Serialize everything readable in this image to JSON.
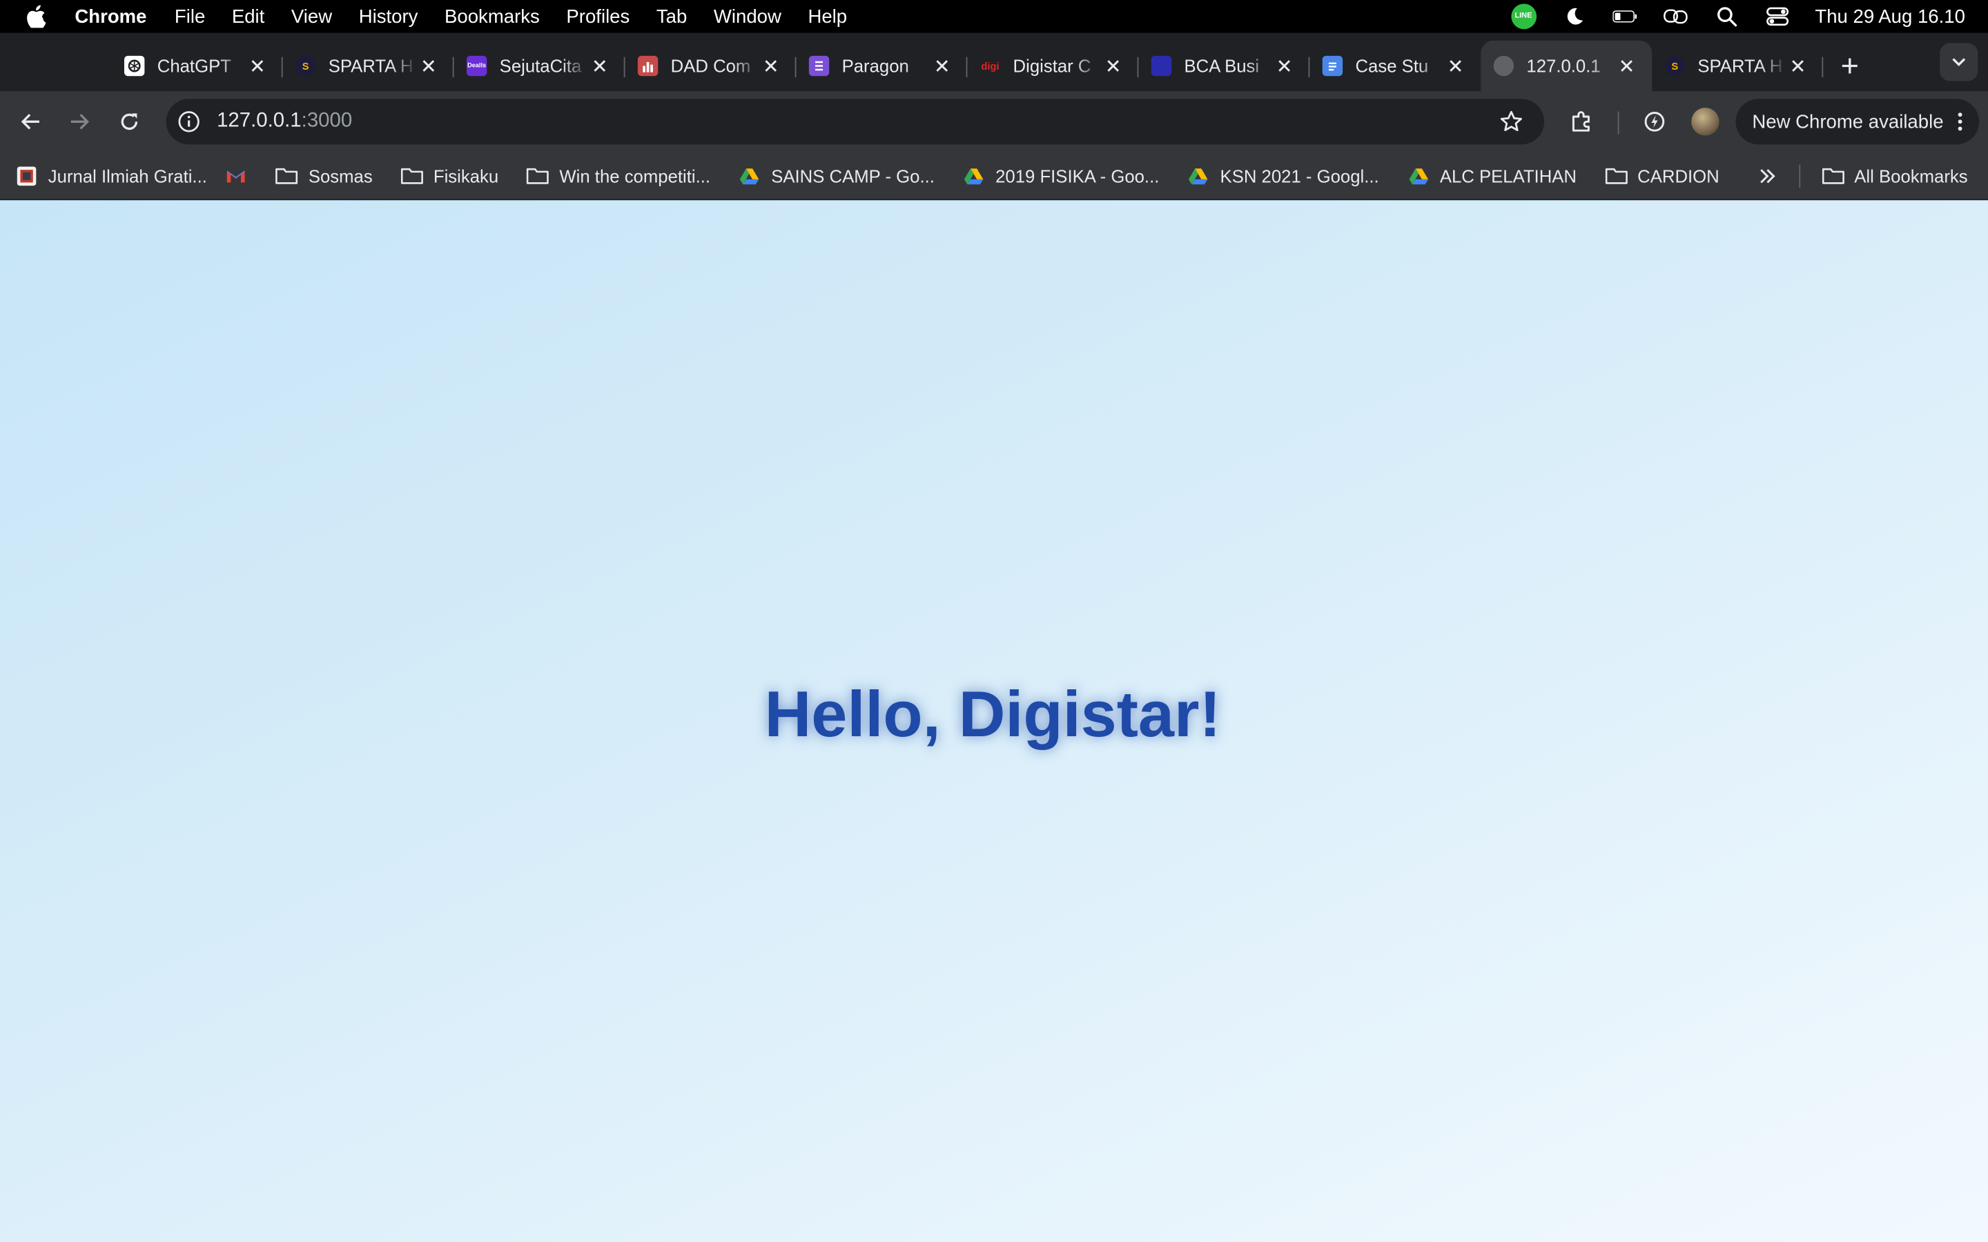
{
  "menubar": {
    "app_name": "Chrome",
    "items": [
      "File",
      "Edit",
      "View",
      "History",
      "Bookmarks",
      "Profiles",
      "Tab",
      "Window",
      "Help"
    ],
    "line_badge": "LINE",
    "clock": "Thu 29 Aug  16.10"
  },
  "tabs": [
    {
      "title": "ChatGPT",
      "icon": "chatgpt-icon",
      "color": "#ffffff"
    },
    {
      "title": "SPARTA H",
      "icon": "sparta-icon",
      "color": "#1c1c3a"
    },
    {
      "title": "SejutaCita",
      "icon": "sejutacita-icon",
      "color": "#6a2fd6"
    },
    {
      "title": "DAD Com",
      "icon": "dad-icon",
      "color": "#c84a4a"
    },
    {
      "title": "Paragon",
      "icon": "forms-icon",
      "color": "#7b4fd6"
    },
    {
      "title": "Digistar C",
      "icon": "digistar-icon",
      "color": "#e02424"
    },
    {
      "title": "BCA Busi",
      "icon": "bca-icon",
      "color": "#2b2bb0"
    },
    {
      "title": "Case Stu",
      "icon": "docs-icon",
      "color": "#4a86e8"
    },
    {
      "title": "127.0.0.1",
      "icon": "globe-icon",
      "color": "#5f6368",
      "active": true
    },
    {
      "title": "SPARTA H",
      "icon": "sparta-icon",
      "color": "#1c1c3a"
    }
  ],
  "omnibox": {
    "host": "127.0.0.1",
    "port": ":3000"
  },
  "update_pill": "New Chrome available",
  "bookmarks": [
    {
      "label": "Jurnal Ilmiah Grati...",
      "icon": "site-favicon"
    },
    {
      "label": "",
      "icon": "gmail-icon"
    },
    {
      "label": "Sosmas",
      "icon": "folder-icon"
    },
    {
      "label": "Fisikaku",
      "icon": "folder-icon"
    },
    {
      "label": "Win the competiti...",
      "icon": "folder-icon"
    },
    {
      "label": "SAINS CAMP - Go...",
      "icon": "drive-icon"
    },
    {
      "label": "2019 FISIKA - Goo...",
      "icon": "drive-icon"
    },
    {
      "label": "KSN 2021 - Googl...",
      "icon": "drive-icon"
    },
    {
      "label": "ALC PELATIHAN",
      "icon": "drive-icon"
    },
    {
      "label": "CARDION",
      "icon": "folder-icon"
    }
  ],
  "all_bookmarks": "All Bookmarks",
  "page": {
    "headline": "Hello, Digistar!"
  }
}
